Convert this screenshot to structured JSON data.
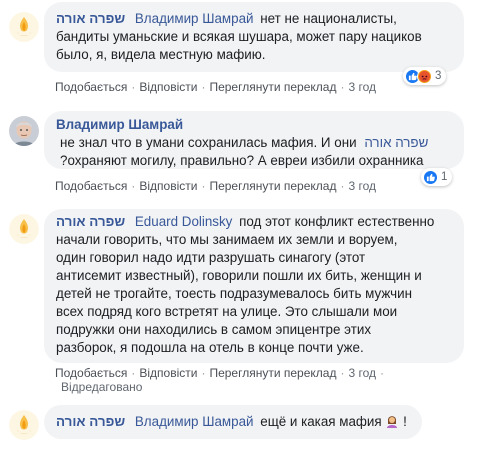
{
  "comments": [
    {
      "author": "שפרה אורה",
      "mention": "Владимир Шамрай",
      "lines": [
        "нет не националисты,",
        "бандиты уманьские и всякая шушара, может пару нациков",
        "было, я, видела местную мафию."
      ],
      "reaction_count": "3",
      "actions": {
        "like": "Подобається",
        "reply": "Відповісти",
        "translate": "Переглянути переклад",
        "time": "3 год"
      }
    },
    {
      "author": "Владимир Шамрай",
      "mention": "שפרה אורה",
      "lines": [
        "не знал что в умани сохранилась мафия. И они",
        "?охраняют могилу, правильно? А евреи избили охранника"
      ],
      "reaction_count": "1",
      "actions": {
        "like": "Подобається",
        "reply": "Відповісти",
        "translate": "Переглянути переклад",
        "time": "3 год"
      }
    },
    {
      "author": "שפרה אורה",
      "mention": "Eduard Dolinsky",
      "lines": [
        "под этот конфликт естественно",
        "начали говорить, что мы занимаем их земли и воруем,",
        "один говорил надо идти разрушать синагогу (этот",
        "антисемит известный), говорили пошли их бить, женщин и",
        "детей не трогайте, тоесть подразумевалось бить мужчин",
        "всех подряд кого встретят на улице. Это слышали мои",
        "подружки они находились в самом эпицентре этих",
        "разборок, я подошла на отель в конце почти уже."
      ],
      "actions": {
        "like": "Подобається",
        "reply": "Відповісти",
        "translate": "Переглянути переклад",
        "time": "3 год"
      },
      "edited": "Відредаговано"
    },
    {
      "author": "שפרה אורה",
      "mention": "Владимир Шамрай",
      "text": "ещё и какая мафия",
      "tail": "!"
    }
  ],
  "icons": {
    "like": "thumbs-up-icon",
    "angry": "angry-face-icon",
    "woman": "woman-shrugging-emoji-icon"
  },
  "colors": {
    "link": "#385898",
    "bubble": "#f2f3f5",
    "like_blue": "#1877f2",
    "angry_orange": "#f4a01a"
  }
}
